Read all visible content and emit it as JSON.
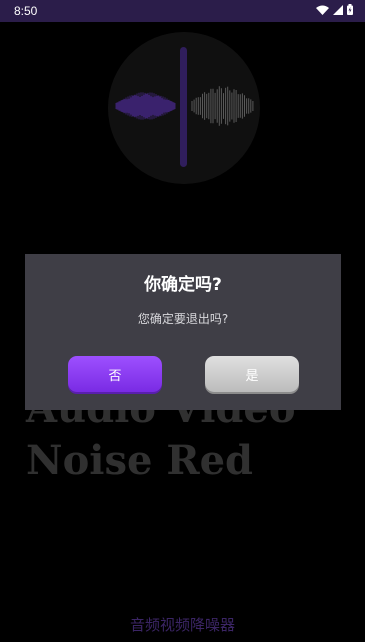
{
  "status_bar": {
    "time": "8:50",
    "icons": [
      "wifi-icon",
      "signal-icon",
      "battery-icon"
    ]
  },
  "hero": {
    "icon": "waveform-icon"
  },
  "background": {
    "title_line1": "Audio Video",
    "title_line2": "Noise Red",
    "app_label": "音频视频降噪器"
  },
  "dialog": {
    "title": "你确定吗?",
    "message": "您确定要退出吗?",
    "no_label": "否",
    "yes_label": "是"
  },
  "colors": {
    "accent": "#8a3cf2",
    "status_bar": "#2b1d4a",
    "dialog_bg": "#3f3e46"
  }
}
